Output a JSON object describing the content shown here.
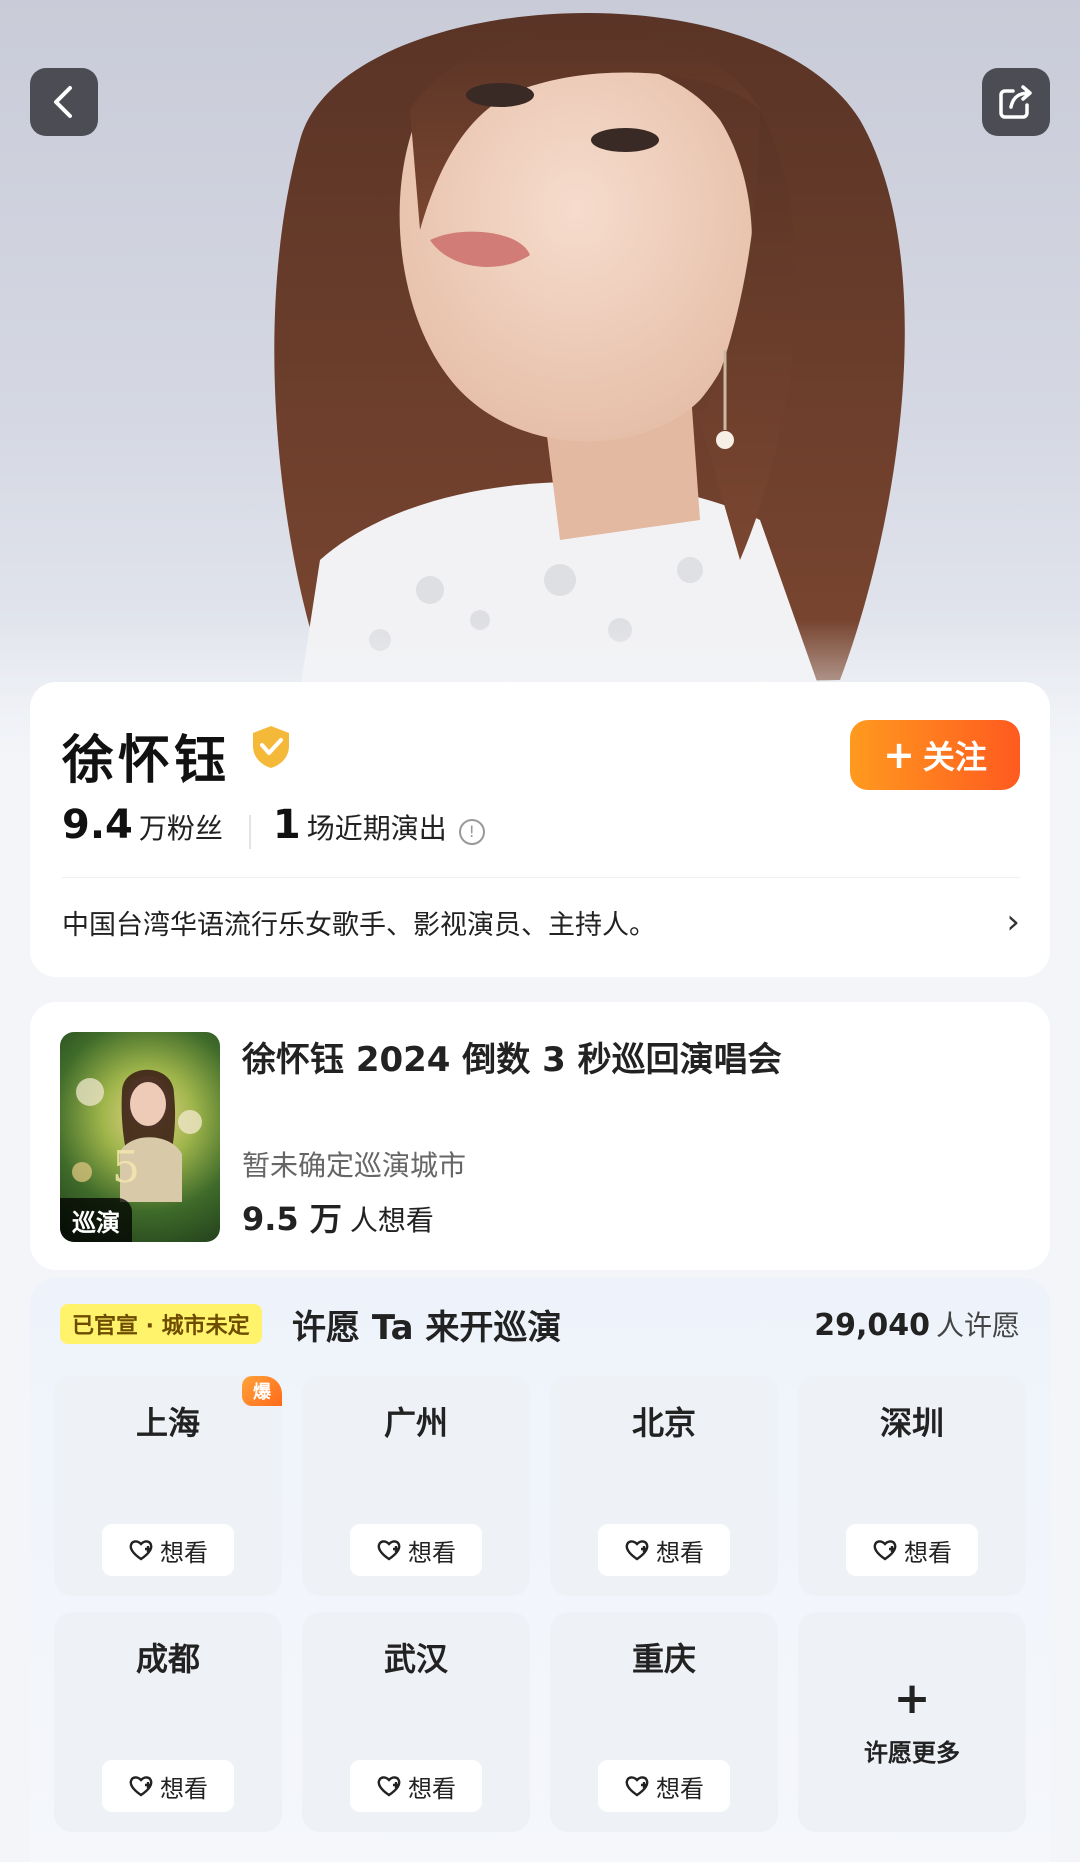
{
  "hero": {
    "back_icon": "chevron-left-icon",
    "share_icon": "share-icon"
  },
  "artist": {
    "name": "徐怀钰",
    "follow_label": "关注",
    "fans_num": "9.4",
    "fans_label": "万粉丝",
    "shows_num": "1",
    "shows_label": "场近期演出",
    "info_icon": "info-icon",
    "bio": "中国台湾华语流行乐女歌手、影视演员、主持人。"
  },
  "concert": {
    "title": "徐怀钰 2024 倒数 3 秒巡回演唱会",
    "poster_tag": "巡演",
    "city_status": "暂未确定巡演城市",
    "want_num": "9.5 万",
    "want_label": "人想看"
  },
  "wish": {
    "badge": "已官宣 · 城市未定",
    "title": "许愿 Ta 来开巡演",
    "count_num": "29,040",
    "count_label": "人许愿",
    "want_btn_label": "想看",
    "cities": [
      {
        "name": "上海",
        "hot": "爆"
      },
      {
        "name": "广州"
      },
      {
        "name": "北京"
      },
      {
        "name": "深圳"
      },
      {
        "name": "成都"
      },
      {
        "name": "武汉"
      },
      {
        "name": "重庆"
      }
    ],
    "more_label": "许愿更多"
  },
  "colors": {
    "accent": "#ff6a1f",
    "badge_yellow": "#fff36b"
  }
}
